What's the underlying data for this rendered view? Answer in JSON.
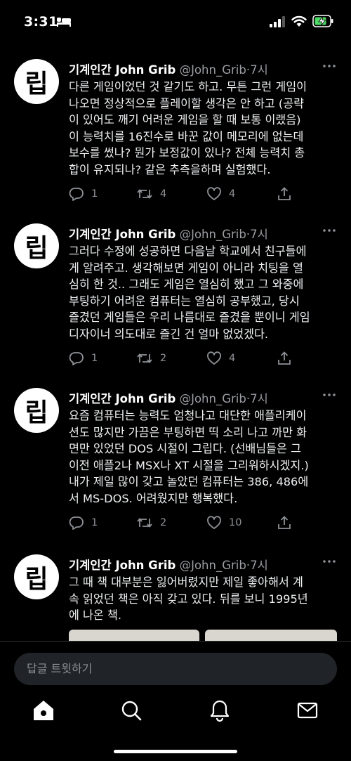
{
  "status": {
    "time": "3:31"
  },
  "tweets": [
    {
      "avatar_text": "립",
      "name": "기계인간 John Grib",
      "handle": "@John_Grib",
      "time": "·7시",
      "text": "다른 게임이었던 것 같기도 하고. 무튼 그런 게임이\n나오면 정상적으로 플레이할 생각은 안 하고 (공략\n이 있어도 깨기 어려운 게임을 할 때 보통 이랬음)\n이 능력치를 16진수로 바꾼 값이 메모리에 없는데\n보수를 썼나? 뭔가 보정값이 있나? 전체 능력치 총\n합이 유지되나? 같은 추측을하며 실험했다.",
      "replies": "1",
      "retweets": "4",
      "likes": "4"
    },
    {
      "avatar_text": "립",
      "name": "기계인간 John Grib",
      "handle": "@John_Grib",
      "time": "·7시",
      "text": "그러다 수정에 성공하면 다음날 학교에서 친구들에\n게 알려주고. 생각해보면 게임이 아니라 치팅을 열\n심히 한 것.. 그래도 게임은 열심히 했고 그 와중에\n부팅하기 어려운 컴퓨터는 열심히 공부했고, 당시\n즐겼던 게임들은 우리 나름대로 즐겼을 뿐이니 게임\n디자이너 의도대로 즐긴 건 얼마 없었겠다.",
      "replies": "1",
      "retweets": "2",
      "likes": "4"
    },
    {
      "avatar_text": "립",
      "name": "기계인간 John Grib",
      "handle": "@John_Grib",
      "time": "·7시",
      "text": "요즘 컴퓨터는 능력도 엄청나고 대단한 애플리케이\n션도 많지만 가끔은 부팅하면 띡 소리 나고 까만 화\n면만 있었던 DOS 시절이 그립다. (선배님들은 그\n이전 애플2나 MSX나 XT 시절을 그리워하시겠지.)\n내가 제일 많이 갖고 놀았던 컴퓨터는 386, 486에\n서 MS-DOS. 어려웠지만 행복했다.",
      "replies": "1",
      "retweets": "2",
      "likes": "10"
    },
    {
      "avatar_text": "립",
      "name": "기계인간 John Grib",
      "handle": "@John_Grib",
      "time": "·7시",
      "text": "그 때 책 대부분은 잃어버렸지만 제일 좋아해서 계\n속 읽었던 책은 아직 갖고 있다. 뒤를 보니 1995년\n에 나온 책."
    }
  ],
  "reply": {
    "placeholder": "답글 트윗하기"
  },
  "colors": {
    "background": "#000000",
    "secondary_text": "#8e9196",
    "input_bg": "#202327",
    "battery": "#4cd964"
  }
}
